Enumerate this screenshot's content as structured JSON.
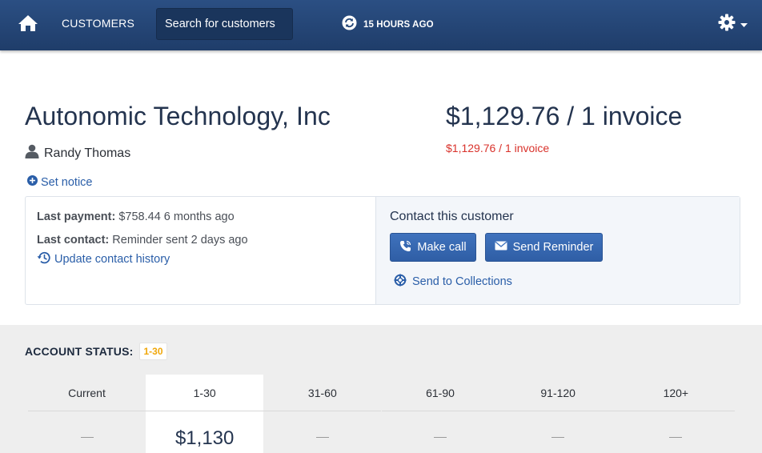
{
  "nav": {
    "customers_label": "CUSTOMERS",
    "search_placeholder": "Search for customers",
    "sync_label": "15 HOURS AGO",
    "icons": [
      "home-icon",
      "sync-icon",
      "gear-icon",
      "caret-down-icon"
    ]
  },
  "customer": {
    "name": "Autonomic Technology, Inc",
    "contact_person": "Randy Thomas",
    "set_notice_label": "Set notice",
    "balance_total": "$1,129.76 / 1 invoice",
    "balance_overdue": "$1,129.76 / 1 invoice"
  },
  "activity": {
    "last_payment_label": "Last payment:",
    "last_payment_value": "$758.44 6 months ago",
    "last_contact_label": "Last contact:",
    "last_contact_value": "Reminder sent 2 days ago",
    "update_history_label": "Update contact history"
  },
  "contact_panel": {
    "title": "Contact this customer",
    "make_call_label": "Make call",
    "send_reminder_label": "Send Reminder",
    "collections_label": "Send to Collections"
  },
  "account_status": {
    "title": "ACCOUNT STATUS:",
    "badge": "1-30",
    "buckets": [
      {
        "label": "Current",
        "value": "—",
        "active": false
      },
      {
        "label": "1-30",
        "value": "$1,130",
        "active": true
      },
      {
        "label": "31-60",
        "value": "—",
        "active": false
      },
      {
        "label": "61-90",
        "value": "—",
        "active": false
      },
      {
        "label": "91-120",
        "value": "—",
        "active": false
      },
      {
        "label": "120+",
        "value": "—",
        "active": false
      }
    ]
  },
  "colors": {
    "nav_bg": "#244677",
    "accent_blue": "#2f5ea5",
    "link_blue": "#2a5ea8",
    "overdue_red": "#d9322b",
    "badge_orange": "#f0a70a"
  }
}
